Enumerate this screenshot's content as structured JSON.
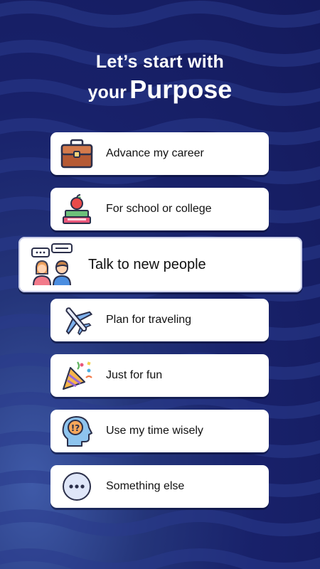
{
  "title": {
    "line1": "Let’s start with",
    "line2_prefix": "your",
    "line2_emphasis": "Purpose"
  },
  "options": [
    {
      "label": "Advance my career",
      "icon": "briefcase-icon",
      "selected": false
    },
    {
      "label": "For school or college",
      "icon": "books-apple-icon",
      "selected": false
    },
    {
      "label": "Talk to new people",
      "icon": "people-chat-icon",
      "selected": true
    },
    {
      "label": "Plan for traveling",
      "icon": "airplane-icon",
      "selected": false
    },
    {
      "label": "Just for fun",
      "icon": "party-popper-icon",
      "selected": false
    },
    {
      "label": "Use my time wisely",
      "icon": "head-brain-icon",
      "selected": false
    },
    {
      "label": "Something else",
      "icon": "more-dots-icon",
      "selected": false
    }
  ],
  "colors": {
    "background_top": "#141a5c",
    "background_glow": "#3f5aa8",
    "card": "#ffffff",
    "text": "#111111"
  }
}
